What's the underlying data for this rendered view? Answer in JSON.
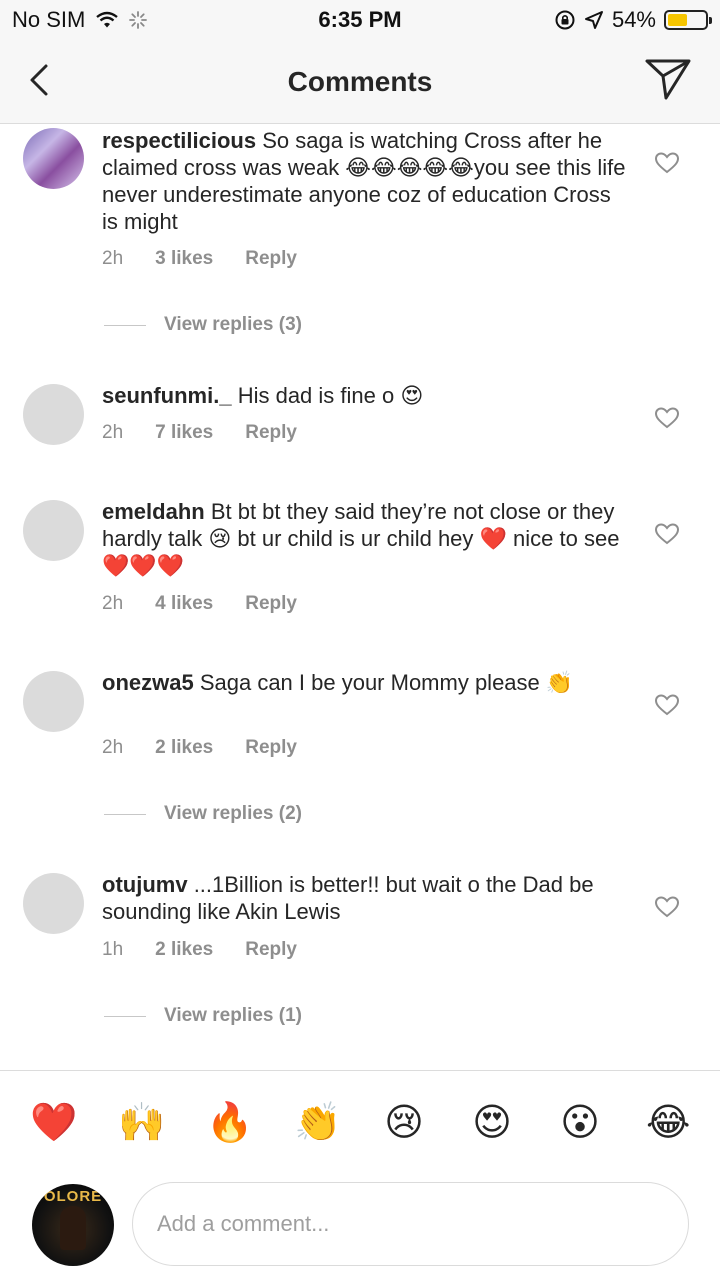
{
  "status_bar": {
    "carrier": "No SIM",
    "time": "6:35 PM",
    "battery": "54%",
    "battery_level": 0.54,
    "icons": [
      "wifi-icon",
      "loading-icon",
      "orientation-lock-icon",
      "location-icon",
      "battery-icon"
    ]
  },
  "header": {
    "title": "Comments",
    "back_icon": "chevron-left-icon",
    "send_icon": "paper-plane-icon"
  },
  "comments": [
    {
      "username": "respectilicious",
      "text": "So saga is watching Cross after he claimed cross was weak 😂😂😂😂😂you see this life never  underestimate anyone coz  of education Cross is might",
      "time": "2h",
      "likes": "3 likes",
      "reply": "Reply",
      "view_replies": "View replies (3)"
    },
    {
      "username": "seunfunmi._",
      "text": "His dad is fine o 😍",
      "time": "2h",
      "likes": "7 likes",
      "reply": "Reply"
    },
    {
      "username": "emeldahn",
      "text": "Bt bt bt they said they’re not close or they hardly talk 😢 bt ur child is ur child hey ❤️ nice to see ❤️❤️❤️",
      "time": "2h",
      "likes": "4 likes",
      "reply": "Reply"
    },
    {
      "username": "onezwa5",
      "text": "Saga can I be your Mommy  please 👏",
      "time": "2h",
      "likes": "2 likes",
      "reply": "Reply",
      "view_replies": "View replies (2)"
    },
    {
      "username": "otujumv",
      "text": "...1Billion is better!! but wait o the Dad be sounding like Akin Lewis",
      "time": "1h",
      "likes": "2 likes",
      "reply": "Reply",
      "view_replies": "View replies (1)"
    }
  ],
  "quick_emojis": [
    "❤️",
    "🙌",
    "🔥",
    "👏",
    "😢",
    "😍",
    "😮",
    "😂"
  ],
  "composer": {
    "avatar_text": "OLORE",
    "placeholder": "Add a comment..."
  }
}
